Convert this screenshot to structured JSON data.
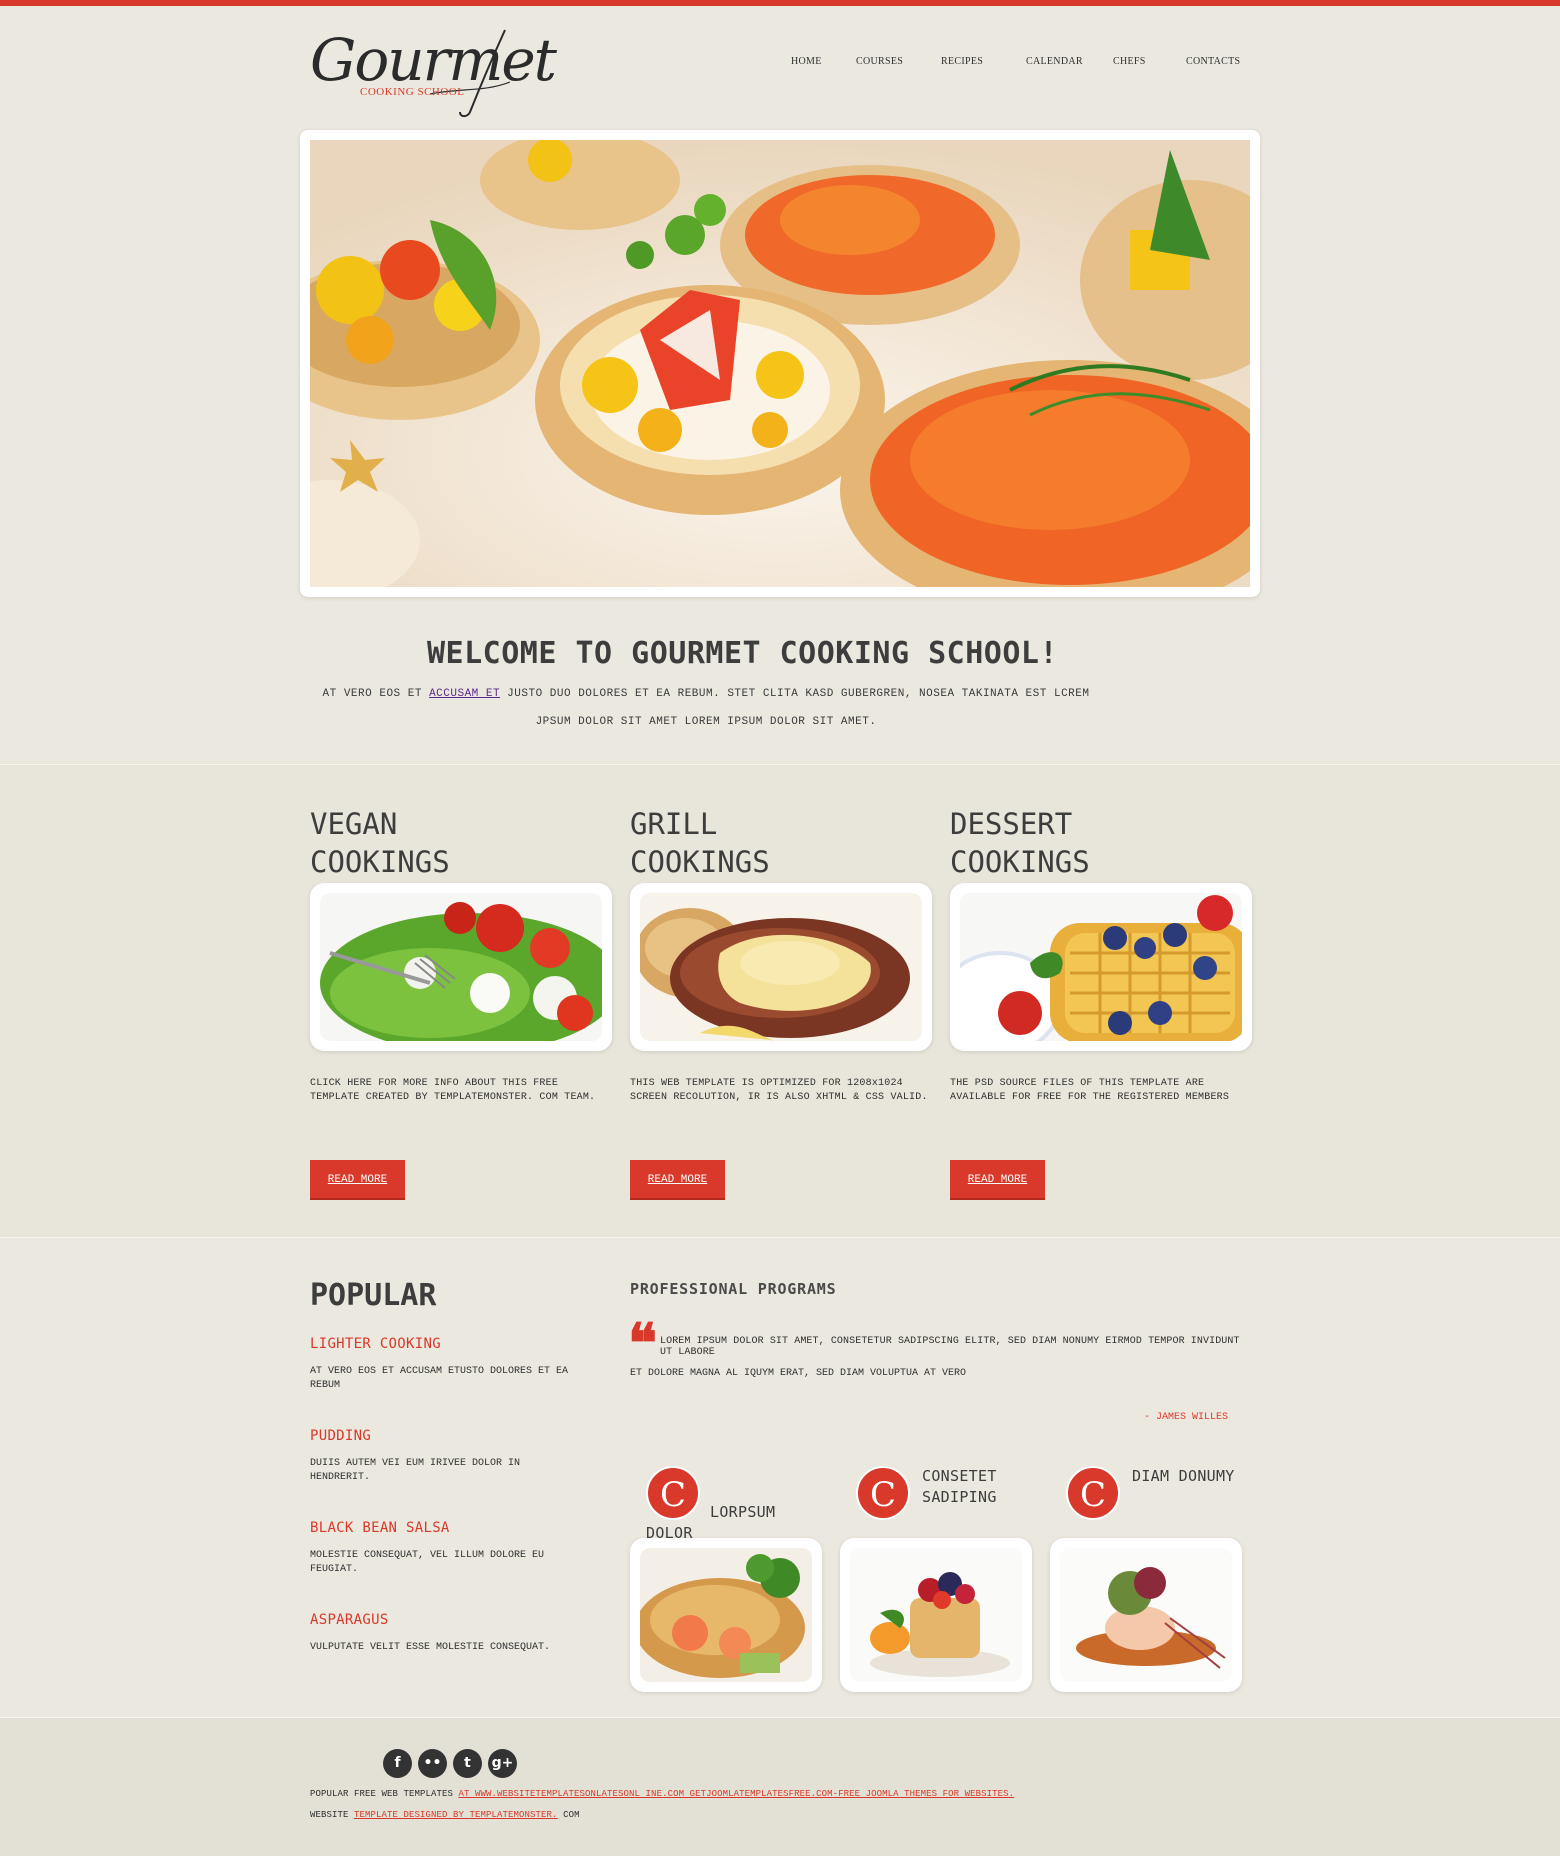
{
  "brand": {
    "logo_text": "Gourmet",
    "logo_sub": "COOKING SCHOOL",
    "accent": "#d8392a"
  },
  "nav": {
    "items": [
      "HOME",
      "COURSES",
      "RECIPES",
      "CALENDAR",
      "CHEFS",
      "CONTACTS"
    ]
  },
  "welcome": {
    "title": "WELCOME TO GOURMET COOKING SCHOOL!",
    "text_before": "AT VERO EOS ET ",
    "text_link": "ACCUSAM ET",
    "text_after": " JUSTO DUO DOLORES ET EA REBUM. STET CLITA KASD GUBERGREN, NOSEA TAKINATA EST LCREM JPSUM DOLOR SIT AMET LOREM IPSUM DOLOR SIT AMET."
  },
  "cookings": [
    {
      "title_line1": "VEGAN",
      "title_line2": "COOKINGS",
      "text": "CLICK HERE FOR MORE INFO ABOUT THIS FREE TEMPLATE CREATED BY TEMPLATEMONSTER. COM TEAM.",
      "button": "READ MORE"
    },
    {
      "title_line1": "GRILL",
      "title_line2": "COOKINGS",
      "text": "THIS WEB TEMPLATE IS OPTIMIZED FOR 1208x1024 SCREEN RECOLUTION, IR IS ALSO XHTML & CSS VALID.",
      "button": "READ MORE"
    },
    {
      "title_line1": "DESSERT",
      "title_line2": "COOKINGS",
      "text": "THE PSD SOURCE FILES OF THIS TEMPLATE ARE AVAILABLE FOR FREE FOR THE REGISTERED MEMBERS",
      "button": "READ MORE"
    }
  ],
  "popular": {
    "title": "POPULAR",
    "items": [
      {
        "title": "LIGHTER COOKING",
        "text": "AT VERO EOS ET ACCUSAM ETUSTO DOLORES ET EA REBUM"
      },
      {
        "title": "PUDDING",
        "text": "DUIIS AUTEM VEI EUM IRIVEE DOLOR IN HENDRERIT."
      },
      {
        "title": "BLACK BEAN SALSA",
        "text": "MOLESTIE CONSEQUAT, VEL ILLUM DOLORE EU FEUGIAT."
      },
      {
        "title": "ASPARAGUS",
        "text": "VULPUTATE VELIT ESSE MOLESTIE CONSEQUAT."
      }
    ]
  },
  "programs": {
    "title": "PROFESSIONAL PROGRAMS",
    "quote_line1": "LOREM IPSUM DOLOR SIT AMET, CONSETETUR SADIPSCING ELITR, SED DIAM NONUMY EIRMOD TEMPOR INVIDUNT UT LABORE",
    "quote_line2": "ET DOLORE MAGNA AL IQUYM ERAT, SED DIAM VOLUPTUA AT VERO",
    "author": "- JAMES WILLES",
    "items": [
      {
        "letter": "C",
        "label_line1": "LORPSUM",
        "label_line2": "DOLOR"
      },
      {
        "letter": "C",
        "label_line1": "CONSETET",
        "label_line2": "SADIPING"
      },
      {
        "letter": "C",
        "label_line1": "DIAM DONUMY",
        "label_line2": ""
      }
    ]
  },
  "footer": {
    "social": [
      "f",
      "••",
      "t",
      "g+"
    ],
    "line1_black": "POPULAR FREE WEB TEMPLATES ",
    "line1_red": "AT WWW.WEBSITETEMPLATESONLATESONL INE.COM GETJOOMLATEMPLATESFREE.COM-FREE JOOMLA THEMES FOR WEBSITES.",
    "line2_black": "WEBSITE ",
    "line2_red": "TEMPLATE DESIGNED BY TEMPLATEMONSTER.",
    "line2_end": " COM"
  }
}
